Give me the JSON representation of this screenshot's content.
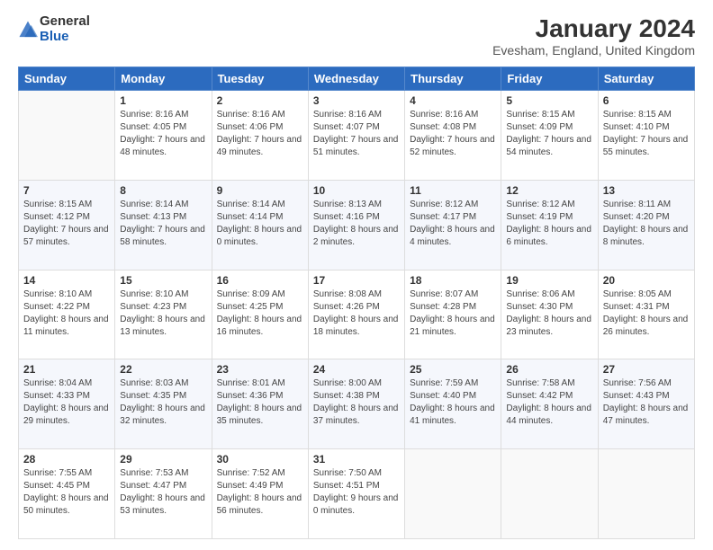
{
  "logo": {
    "general": "General",
    "blue": "Blue"
  },
  "title": "January 2024",
  "subtitle": "Evesham, England, United Kingdom",
  "headers": [
    "Sunday",
    "Monday",
    "Tuesday",
    "Wednesday",
    "Thursday",
    "Friday",
    "Saturday"
  ],
  "weeks": [
    [
      {
        "day": "",
        "sunrise": "",
        "sunset": "",
        "daylight": ""
      },
      {
        "day": "1",
        "sunrise": "Sunrise: 8:16 AM",
        "sunset": "Sunset: 4:05 PM",
        "daylight": "Daylight: 7 hours and 48 minutes."
      },
      {
        "day": "2",
        "sunrise": "Sunrise: 8:16 AM",
        "sunset": "Sunset: 4:06 PM",
        "daylight": "Daylight: 7 hours and 49 minutes."
      },
      {
        "day": "3",
        "sunrise": "Sunrise: 8:16 AM",
        "sunset": "Sunset: 4:07 PM",
        "daylight": "Daylight: 7 hours and 51 minutes."
      },
      {
        "day": "4",
        "sunrise": "Sunrise: 8:16 AM",
        "sunset": "Sunset: 4:08 PM",
        "daylight": "Daylight: 7 hours and 52 minutes."
      },
      {
        "day": "5",
        "sunrise": "Sunrise: 8:15 AM",
        "sunset": "Sunset: 4:09 PM",
        "daylight": "Daylight: 7 hours and 54 minutes."
      },
      {
        "day": "6",
        "sunrise": "Sunrise: 8:15 AM",
        "sunset": "Sunset: 4:10 PM",
        "daylight": "Daylight: 7 hours and 55 minutes."
      }
    ],
    [
      {
        "day": "7",
        "sunrise": "Sunrise: 8:15 AM",
        "sunset": "Sunset: 4:12 PM",
        "daylight": "Daylight: 7 hours and 57 minutes."
      },
      {
        "day": "8",
        "sunrise": "Sunrise: 8:14 AM",
        "sunset": "Sunset: 4:13 PM",
        "daylight": "Daylight: 7 hours and 58 minutes."
      },
      {
        "day": "9",
        "sunrise": "Sunrise: 8:14 AM",
        "sunset": "Sunset: 4:14 PM",
        "daylight": "Daylight: 8 hours and 0 minutes."
      },
      {
        "day": "10",
        "sunrise": "Sunrise: 8:13 AM",
        "sunset": "Sunset: 4:16 PM",
        "daylight": "Daylight: 8 hours and 2 minutes."
      },
      {
        "day": "11",
        "sunrise": "Sunrise: 8:12 AM",
        "sunset": "Sunset: 4:17 PM",
        "daylight": "Daylight: 8 hours and 4 minutes."
      },
      {
        "day": "12",
        "sunrise": "Sunrise: 8:12 AM",
        "sunset": "Sunset: 4:19 PM",
        "daylight": "Daylight: 8 hours and 6 minutes."
      },
      {
        "day": "13",
        "sunrise": "Sunrise: 8:11 AM",
        "sunset": "Sunset: 4:20 PM",
        "daylight": "Daylight: 8 hours and 8 minutes."
      }
    ],
    [
      {
        "day": "14",
        "sunrise": "Sunrise: 8:10 AM",
        "sunset": "Sunset: 4:22 PM",
        "daylight": "Daylight: 8 hours and 11 minutes."
      },
      {
        "day": "15",
        "sunrise": "Sunrise: 8:10 AM",
        "sunset": "Sunset: 4:23 PM",
        "daylight": "Daylight: 8 hours and 13 minutes."
      },
      {
        "day": "16",
        "sunrise": "Sunrise: 8:09 AM",
        "sunset": "Sunset: 4:25 PM",
        "daylight": "Daylight: 8 hours and 16 minutes."
      },
      {
        "day": "17",
        "sunrise": "Sunrise: 8:08 AM",
        "sunset": "Sunset: 4:26 PM",
        "daylight": "Daylight: 8 hours and 18 minutes."
      },
      {
        "day": "18",
        "sunrise": "Sunrise: 8:07 AM",
        "sunset": "Sunset: 4:28 PM",
        "daylight": "Daylight: 8 hours and 21 minutes."
      },
      {
        "day": "19",
        "sunrise": "Sunrise: 8:06 AM",
        "sunset": "Sunset: 4:30 PM",
        "daylight": "Daylight: 8 hours and 23 minutes."
      },
      {
        "day": "20",
        "sunrise": "Sunrise: 8:05 AM",
        "sunset": "Sunset: 4:31 PM",
        "daylight": "Daylight: 8 hours and 26 minutes."
      }
    ],
    [
      {
        "day": "21",
        "sunrise": "Sunrise: 8:04 AM",
        "sunset": "Sunset: 4:33 PM",
        "daylight": "Daylight: 8 hours and 29 minutes."
      },
      {
        "day": "22",
        "sunrise": "Sunrise: 8:03 AM",
        "sunset": "Sunset: 4:35 PM",
        "daylight": "Daylight: 8 hours and 32 minutes."
      },
      {
        "day": "23",
        "sunrise": "Sunrise: 8:01 AM",
        "sunset": "Sunset: 4:36 PM",
        "daylight": "Daylight: 8 hours and 35 minutes."
      },
      {
        "day": "24",
        "sunrise": "Sunrise: 8:00 AM",
        "sunset": "Sunset: 4:38 PM",
        "daylight": "Daylight: 8 hours and 37 minutes."
      },
      {
        "day": "25",
        "sunrise": "Sunrise: 7:59 AM",
        "sunset": "Sunset: 4:40 PM",
        "daylight": "Daylight: 8 hours and 41 minutes."
      },
      {
        "day": "26",
        "sunrise": "Sunrise: 7:58 AM",
        "sunset": "Sunset: 4:42 PM",
        "daylight": "Daylight: 8 hours and 44 minutes."
      },
      {
        "day": "27",
        "sunrise": "Sunrise: 7:56 AM",
        "sunset": "Sunset: 4:43 PM",
        "daylight": "Daylight: 8 hours and 47 minutes."
      }
    ],
    [
      {
        "day": "28",
        "sunrise": "Sunrise: 7:55 AM",
        "sunset": "Sunset: 4:45 PM",
        "daylight": "Daylight: 8 hours and 50 minutes."
      },
      {
        "day": "29",
        "sunrise": "Sunrise: 7:53 AM",
        "sunset": "Sunset: 4:47 PM",
        "daylight": "Daylight: 8 hours and 53 minutes."
      },
      {
        "day": "30",
        "sunrise": "Sunrise: 7:52 AM",
        "sunset": "Sunset: 4:49 PM",
        "daylight": "Daylight: 8 hours and 56 minutes."
      },
      {
        "day": "31",
        "sunrise": "Sunrise: 7:50 AM",
        "sunset": "Sunset: 4:51 PM",
        "daylight": "Daylight: 9 hours and 0 minutes."
      },
      {
        "day": "",
        "sunrise": "",
        "sunset": "",
        "daylight": ""
      },
      {
        "day": "",
        "sunrise": "",
        "sunset": "",
        "daylight": ""
      },
      {
        "day": "",
        "sunrise": "",
        "sunset": "",
        "daylight": ""
      }
    ]
  ]
}
